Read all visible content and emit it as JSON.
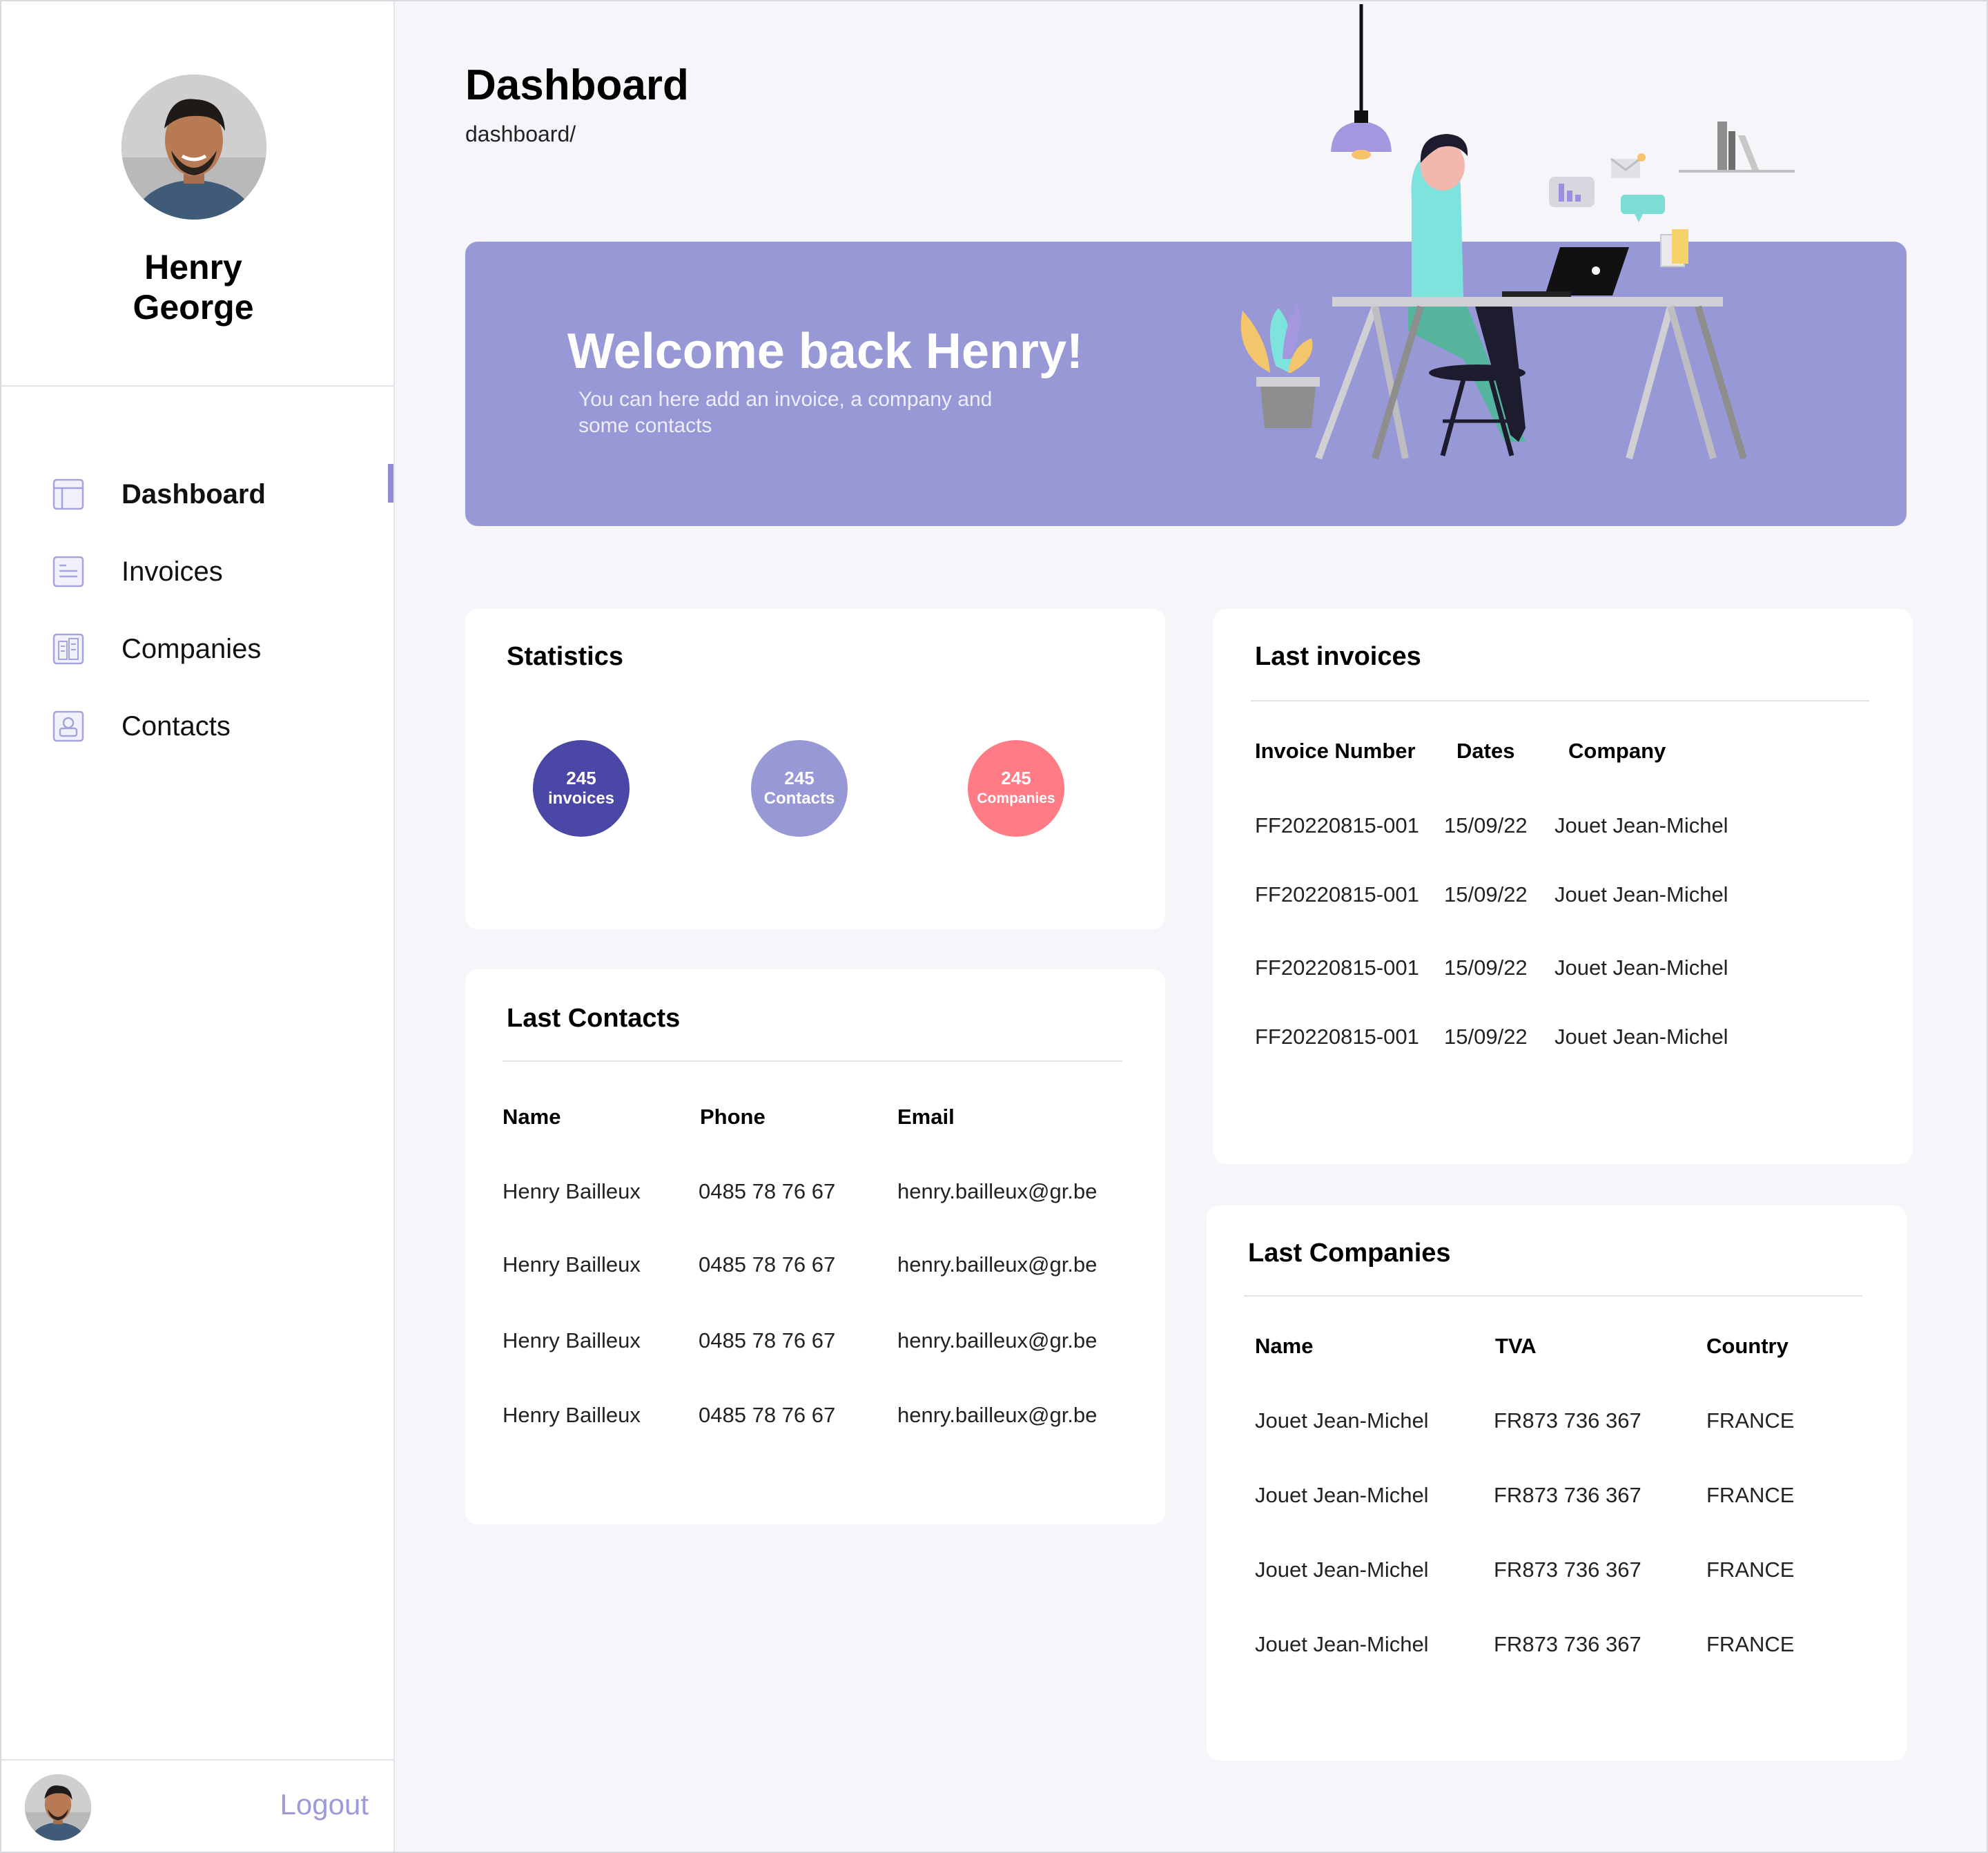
{
  "user": {
    "name_line1": "Henry",
    "name_line2": "George"
  },
  "sidebar": {
    "items": [
      {
        "label": "Dashboard",
        "icon": "layout-icon",
        "active": true
      },
      {
        "label": "Invoices",
        "icon": "invoice-icon",
        "active": false
      },
      {
        "label": "Companies",
        "icon": "building-icon",
        "active": false
      },
      {
        "label": "Contacts",
        "icon": "contact-icon",
        "active": false
      }
    ],
    "logout_label": "Logout"
  },
  "header": {
    "title": "Dashboard",
    "breadcrumb": "dashboard/"
  },
  "banner": {
    "title": "Welcome back Henry!",
    "subtitle": "You can here add an invoice, a company and some contacts"
  },
  "statistics": {
    "title": "Statistics",
    "items": [
      {
        "value": "245",
        "label": "invoices",
        "color": "#4B47A6"
      },
      {
        "value": "245",
        "label": "Contacts",
        "color": "#9898D6"
      },
      {
        "value": "245",
        "label": "Companies",
        "color": "#FF7B86"
      }
    ]
  },
  "last_invoices": {
    "title": "Last invoices",
    "columns": [
      "Invoice Number",
      "Dates",
      "Company"
    ],
    "rows": [
      [
        "FF20220815-001",
        "15/09/22",
        "Jouet Jean-Michel"
      ],
      [
        "FF20220815-001",
        "15/09/22",
        "Jouet Jean-Michel"
      ],
      [
        "FF20220815-001",
        "15/09/22",
        "Jouet Jean-Michel"
      ],
      [
        "FF20220815-001",
        "15/09/22",
        "Jouet Jean-Michel"
      ]
    ]
  },
  "last_contacts": {
    "title": "Last Contacts",
    "columns": [
      "Name",
      "Phone",
      "Email"
    ],
    "rows": [
      [
        "Henry Bailleux",
        "0485 78 76 67",
        "henry.bailleux@gr.be"
      ],
      [
        "Henry Bailleux",
        "0485 78 76 67",
        "henry.bailleux@gr.be"
      ],
      [
        "Henry Bailleux",
        "0485 78 76 67",
        "henry.bailleux@gr.be"
      ],
      [
        "Henry Bailleux",
        "0485 78 76 67",
        "henry.bailleux@gr.be"
      ]
    ]
  },
  "last_companies": {
    "title": "Last Companies",
    "columns": [
      "Name",
      "TVA",
      "Country"
    ],
    "rows": [
      [
        "Jouet Jean-Michel",
        "FR873 736 367",
        "FRANCE"
      ],
      [
        "Jouet Jean-Michel",
        "FR873 736 367",
        "FRANCE"
      ],
      [
        "Jouet Jean-Michel",
        "FR873 736 367",
        "FRANCE"
      ],
      [
        "Jouet Jean-Michel",
        "FR873 736 367",
        "FRANCE"
      ]
    ]
  },
  "colors": {
    "accent": "#9898D6",
    "dark_accent": "#4B47A6",
    "pink": "#FF7B86",
    "background": "#F5F5FA"
  }
}
